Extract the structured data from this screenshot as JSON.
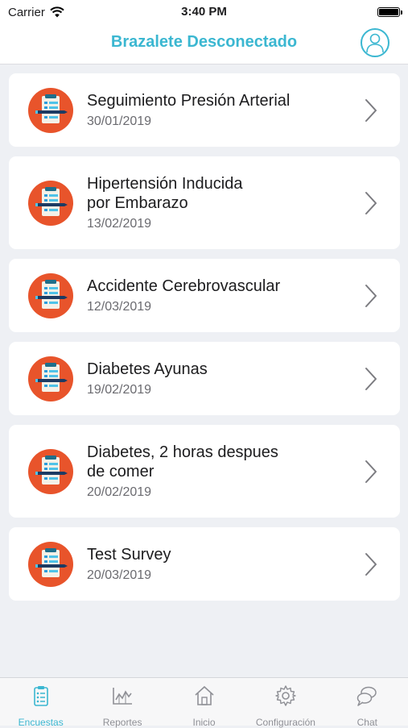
{
  "status_bar": {
    "carrier": "Carrier",
    "time": "3:40 PM"
  },
  "nav": {
    "title": "Brazalete Desconectado",
    "profile_icon": "user-circle-icon"
  },
  "surveys": [
    {
      "title": "Seguimiento Presión Arterial",
      "date": "30/01/2019"
    },
    {
      "title": "Hipertensión Inducida\npor Embarazo",
      "date": "13/02/2019"
    },
    {
      "title": "Accidente Cerebrovascular",
      "date": "12/03/2019"
    },
    {
      "title": "Diabetes Ayunas",
      "date": "19/02/2019"
    },
    {
      "title": "Diabetes, 2 horas despues\nde comer",
      "date": "20/02/2019"
    },
    {
      "title": "Test Survey",
      "date": "20/03/2019"
    }
  ],
  "tabs": [
    {
      "label": "Encuestas",
      "icon": "clipboard-icon",
      "active": true
    },
    {
      "label": "Reportes",
      "icon": "chart-icon",
      "active": false
    },
    {
      "label": "Inicio",
      "icon": "home-icon",
      "active": false
    },
    {
      "label": "Configuración",
      "icon": "gear-icon",
      "active": false
    },
    {
      "label": "Chat",
      "icon": "chat-icon",
      "active": false
    }
  ],
  "colors": {
    "accent": "#3bb7d1",
    "icon_orange": "#e8542b",
    "inactive": "#8f9096"
  }
}
